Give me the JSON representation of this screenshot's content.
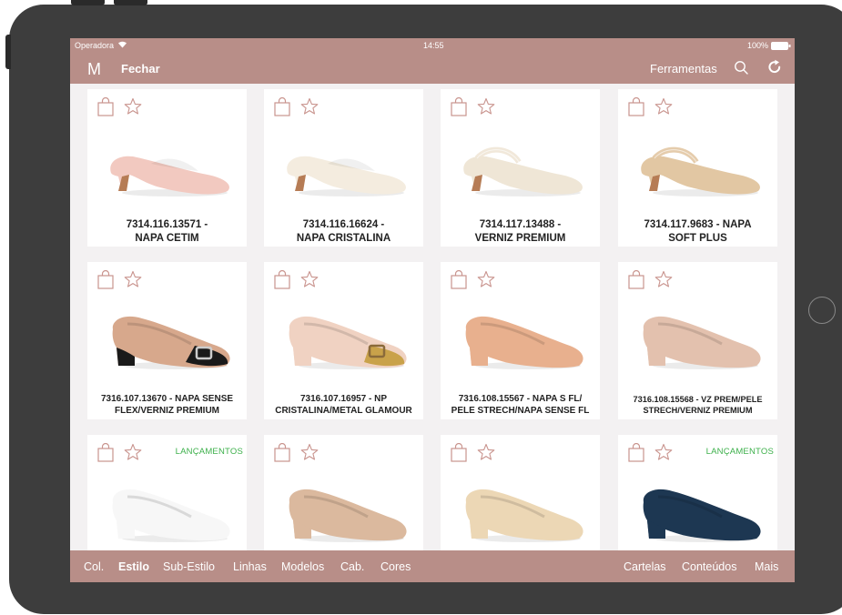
{
  "status_bar": {
    "carrier": "Operadora",
    "time": "14:55",
    "battery": "100%"
  },
  "navbar": {
    "logo": "M",
    "close_label": "Fechar",
    "tools_label": "Ferramentas"
  },
  "products": [
    {
      "line1": "7314.116.13571 -",
      "line2": "NAPA CETIM",
      "badge": "",
      "shoe_color": "#f2c9c0"
    },
    {
      "line1": "7314.116.16624 -",
      "line2": "NAPA CRISTALINA",
      "badge": "",
      "shoe_color": "#f4ecdf"
    },
    {
      "line1": "7314.117.13488 -",
      "line2": "VERNIZ PREMIUM",
      "badge": "",
      "shoe_color": "#efe6d6"
    },
    {
      "line1": "7314.117.9683 - NAPA",
      "line2": "SOFT PLUS",
      "badge": "",
      "shoe_color": "#e2c7a3"
    },
    {
      "line1": "7316.107.13670 - NAPA SENSE",
      "line2": "FLEX/VERNIZ PREMIUM",
      "badge": "",
      "shoe_color": "#d7a88c"
    },
    {
      "line1": "7316.107.16957 - NP",
      "line2": "CRISTALINA/METAL GLAMOUR",
      "badge": "",
      "shoe_color": "#f0d2c2"
    },
    {
      "line1": "7316.108.15567 - NAPA S FL/",
      "line2": "PELE STRECH/NAPA SENSE FL",
      "badge": "",
      "shoe_color": "#e8b08e"
    },
    {
      "line1": "7316.108.15568 - VZ PREM/PELE",
      "line2": "STRECH/VERNIZ PREMIUM",
      "badge": "",
      "shoe_color": "#e3c1ae"
    },
    {
      "line1": "",
      "line2": "",
      "badge": "LANÇAMENTOS",
      "shoe_color": "#f7f7f7"
    },
    {
      "line1": "",
      "line2": "",
      "badge": "",
      "shoe_color": "#dbb99e"
    },
    {
      "line1": "",
      "line2": "",
      "badge": "",
      "shoe_color": "#ecd7b5"
    },
    {
      "line1": "",
      "line2": "",
      "badge": "LANÇAMENTOS",
      "shoe_color": "#1d3752"
    }
  ],
  "bottom_tabs": {
    "left": [
      "Col.",
      "Estilo",
      "Sub-Estilo",
      "Linhas",
      "Modelos",
      "Cab.",
      "Cores"
    ],
    "right": [
      "Cartelas",
      "Conteúdos",
      "Mais"
    ],
    "active": "Estilo"
  },
  "colors": {
    "accent": "#b88e88",
    "badge": "#3db04b",
    "icon": "#c9948e"
  }
}
